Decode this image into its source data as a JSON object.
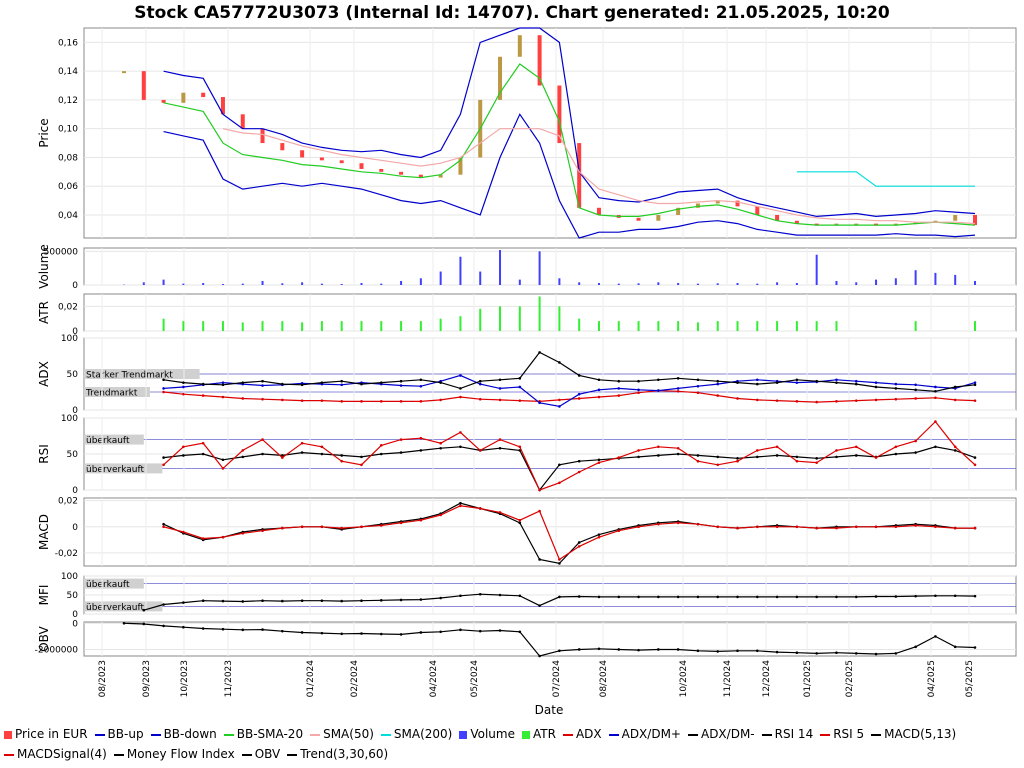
{
  "chart_data": {
    "type": "line",
    "title": "Stock CA57772U3073 (Internal Id: 14707). Chart generated: 21.05.2025, 10:20",
    "xlabel": "Date",
    "x_ticks": [
      "08/2023",
      "09/2023",
      "10/2023",
      "11/2023",
      "01/2024",
      "02/2024",
      "04/2024",
      "05/2024",
      "07/2024",
      "08/2024",
      "10/2024",
      "11/2024",
      "12/2024",
      "01/2025",
      "02/2025",
      "04/2025",
      "05/2025"
    ],
    "panels": [
      {
        "id": "price",
        "ylabel": "Price",
        "ylim": [
          0.024,
          0.17
        ],
        "ticks": [
          "0,16",
          "0,14",
          "0,12",
          "0,10",
          "0,08",
          "0,06",
          "0,04"
        ],
        "tick_values": [
          0.16,
          0.14,
          0.12,
          0.1,
          0.08,
          0.06,
          0.04
        ]
      },
      {
        "id": "volume",
        "ylabel": "Volume",
        "ylim": [
          0,
          550000
        ],
        "ticks": [
          "500000",
          "0"
        ],
        "tick_values": [
          500000,
          0
        ]
      },
      {
        "id": "atr",
        "ylabel": "ATR",
        "ylim": [
          0,
          0.03
        ],
        "ticks": [
          "0,02",
          "0"
        ],
        "tick_values": [
          0.02,
          0
        ]
      },
      {
        "id": "adx",
        "ylabel": "ADX",
        "ylim": [
          0,
          100
        ],
        "ticks": [
          "100",
          "50",
          "0"
        ],
        "tick_values": [
          100,
          50,
          0
        ],
        "annotations": [
          {
            "text": "Starker Trendmarkt",
            "value": 50
          },
          {
            "text": "Trendmarkt",
            "value": 25
          }
        ]
      },
      {
        "id": "rsi",
        "ylabel": "RSI",
        "ylim": [
          0,
          100
        ],
        "ticks": [
          "100",
          "50",
          "0"
        ],
        "tick_values": [
          100,
          50,
          0
        ],
        "annotations": [
          {
            "text": "überkauft",
            "value": 70
          },
          {
            "text": "überverkauft",
            "value": 30
          }
        ]
      },
      {
        "id": "macd",
        "ylabel": "MACD",
        "ylim": [
          -0.03,
          0.022
        ],
        "ticks": [
          "0,02",
          "0",
          "-0,02"
        ],
        "tick_values": [
          0.02,
          0,
          -0.02
        ]
      },
      {
        "id": "mfi",
        "ylabel": "MFI",
        "ylim": [
          0,
          100
        ],
        "ticks": [
          "100",
          "50",
          "0"
        ],
        "tick_values": [
          100,
          50,
          0
        ],
        "annotations": [
          {
            "text": "überkauft",
            "value": 80
          },
          {
            "text": "überverkauft",
            "value": 20
          }
        ]
      },
      {
        "id": "obv",
        "ylabel": "OBV",
        "ylim": [
          -2500000,
          100000
        ],
        "ticks": [
          "0",
          "-2000000"
        ],
        "tick_values": [
          0,
          -2000000
        ]
      }
    ],
    "series": [
      {
        "name": "Price in EUR",
        "panel": "price",
        "color": "#ff4040",
        "values": [
          0.14,
          0.12,
          0.118,
          0.125,
          0.122,
          0.11,
          0.1,
          0.09,
          0.085,
          0.08,
          0.078,
          0.076,
          0.072,
          0.07,
          0.068,
          0.066,
          0.068,
          0.08,
          0.12,
          0.15,
          0.165,
          0.13,
          0.09,
          0.045,
          0.04,
          0.038,
          0.036,
          0.04,
          0.045,
          0.048,
          0.05,
          0.046,
          0.04,
          0.036,
          0.034,
          0.033,
          0.034,
          0.034,
          0.033,
          0.034,
          0.035,
          0.036,
          0.04,
          0.033
        ]
      },
      {
        "name": "BB-up",
        "panel": "price",
        "color": "#0000cc",
        "values": [
          null,
          null,
          0.14,
          0.137,
          0.135,
          0.11,
          0.1,
          0.1,
          0.096,
          0.09,
          0.087,
          0.085,
          0.084,
          0.085,
          0.082,
          0.08,
          0.085,
          0.11,
          0.16,
          0.165,
          0.175,
          0.18,
          0.16,
          0.07,
          0.052,
          0.05,
          0.049,
          0.052,
          0.056,
          0.057,
          0.058,
          0.052,
          0.048,
          0.045,
          0.042,
          0.039,
          0.04,
          0.041,
          0.039,
          0.04,
          0.041,
          0.043,
          0.042,
          0.041
        ]
      },
      {
        "name": "BB-down",
        "panel": "price",
        "color": "#0000cc",
        "values": [
          null,
          null,
          0.098,
          0.095,
          0.092,
          0.065,
          0.058,
          0.06,
          0.062,
          0.06,
          0.062,
          0.06,
          0.058,
          0.054,
          0.05,
          0.048,
          0.05,
          0.045,
          0.04,
          0.08,
          0.11,
          0.09,
          0.05,
          0.01,
          0.028,
          0.028,
          0.03,
          0.03,
          0.032,
          0.035,
          0.036,
          0.034,
          0.03,
          0.028,
          0.026,
          0.026,
          0.026,
          0.026,
          0.026,
          0.027,
          0.026,
          0.026,
          0.025,
          0.026
        ]
      },
      {
        "name": "BB-SMA-20",
        "panel": "price",
        "color": "#22cc22",
        "values": [
          null,
          null,
          0.118,
          0.115,
          0.112,
          0.09,
          0.082,
          0.08,
          0.078,
          0.075,
          0.074,
          0.072,
          0.07,
          0.069,
          0.067,
          0.066,
          0.068,
          0.078,
          0.1,
          0.125,
          0.145,
          0.135,
          0.105,
          0.045,
          0.04,
          0.039,
          0.039,
          0.041,
          0.044,
          0.046,
          0.047,
          0.044,
          0.04,
          0.036,
          0.034,
          0.033,
          0.033,
          0.033,
          0.033,
          0.033,
          0.034,
          0.035,
          0.034,
          0.033
        ]
      },
      {
        "name": "SMA(50)",
        "panel": "price",
        "color": "#f4a8a8",
        "values": [
          null,
          null,
          null,
          null,
          null,
          0.1,
          0.097,
          0.096,
          0.092,
          0.088,
          0.085,
          0.082,
          0.08,
          0.078,
          0.076,
          0.074,
          0.076,
          0.08,
          0.09,
          0.1,
          0.1,
          0.1,
          0.095,
          0.07,
          0.058,
          0.054,
          0.05,
          0.048,
          0.048,
          0.049,
          0.05,
          0.049,
          0.046,
          0.043,
          0.04,
          0.038,
          0.037,
          0.037,
          0.036,
          0.036,
          0.035,
          0.035,
          0.035,
          0.034
        ]
      },
      {
        "name": "SMA(200)",
        "panel": "price",
        "color": "#00dddd",
        "values": [
          null,
          null,
          null,
          null,
          null,
          null,
          null,
          null,
          null,
          null,
          null,
          null,
          null,
          null,
          null,
          null,
          null,
          null,
          null,
          null,
          null,
          null,
          null,
          null,
          null,
          null,
          null,
          null,
          null,
          null,
          null,
          null,
          null,
          null,
          0.07,
          0.07,
          0.07,
          0.07,
          0.06,
          0.06,
          0.06,
          0.06,
          0.06,
          0.06
        ]
      },
      {
        "name": "Volume",
        "panel": "volume",
        "color": "#4040ff",
        "values": [
          5000,
          40000,
          80000,
          20000,
          30000,
          15000,
          20000,
          60000,
          25000,
          40000,
          20000,
          15000,
          30000,
          20000,
          60000,
          100000,
          200000,
          420000,
          200000,
          520000,
          80000,
          500000,
          100000,
          40000,
          30000,
          20000,
          25000,
          40000,
          30000,
          20000,
          25000,
          30000,
          20000,
          40000,
          30000,
          450000,
          60000,
          40000,
          80000,
          100000,
          220000,
          180000,
          150000,
          60000
        ]
      },
      {
        "name": "ATR",
        "panel": "atr",
        "color": "#33ee33",
        "values": [
          null,
          null,
          0.01,
          0.008,
          0.008,
          0.008,
          0.007,
          0.008,
          0.008,
          0.007,
          0.008,
          0.008,
          0.008,
          0.008,
          0.008,
          0.008,
          0.01,
          0.012,
          0.018,
          0.02,
          0.02,
          0.028,
          0.02,
          0.01,
          0.008,
          0.008,
          0.008,
          0.008,
          0.008,
          0.007,
          0.008,
          0.008,
          0.008,
          0.008,
          0.008,
          0.008,
          0.008,
          null,
          null,
          null,
          0.008,
          null,
          null,
          0.008
        ]
      },
      {
        "name": "ADX",
        "panel": "adx",
        "color": "#dd0000",
        "values": [
          null,
          null,
          25,
          22,
          20,
          18,
          16,
          15,
          14,
          13,
          13,
          12,
          12,
          12,
          12,
          12,
          14,
          18,
          15,
          14,
          13,
          12,
          14,
          16,
          18,
          20,
          24,
          27,
          26,
          24,
          20,
          16,
          14,
          13,
          12,
          11,
          12,
          13,
          14,
          15,
          16,
          17,
          14,
          13
        ]
      },
      {
        "name": "ADX/DM+",
        "panel": "adx",
        "color": "#0000cc",
        "values": [
          null,
          null,
          30,
          32,
          35,
          38,
          36,
          34,
          35,
          37,
          36,
          35,
          38,
          36,
          34,
          33,
          40,
          48,
          36,
          30,
          32,
          10,
          5,
          22,
          28,
          30,
          28,
          27,
          30,
          33,
          36,
          40,
          42,
          40,
          38,
          39,
          42,
          40,
          38,
          36,
          35,
          32,
          30,
          38
        ]
      },
      {
        "name": "ADX/DM-",
        "panel": "adx",
        "color": "#000000",
        "values": [
          null,
          null,
          42,
          38,
          36,
          35,
          38,
          40,
          36,
          35,
          38,
          40,
          36,
          38,
          40,
          42,
          38,
          30,
          40,
          42,
          44,
          80,
          66,
          48,
          42,
          40,
          40,
          42,
          44,
          42,
          40,
          38,
          36,
          38,
          42,
          40,
          38,
          36,
          32,
          30,
          28,
          26,
          32,
          35
        ]
      },
      {
        "name": "RSI 14",
        "panel": "rsi",
        "color": "#000000",
        "values": [
          null,
          null,
          45,
          48,
          50,
          42,
          46,
          50,
          48,
          52,
          50,
          48,
          46,
          50,
          52,
          55,
          58,
          60,
          55,
          58,
          55,
          0,
          35,
          40,
          42,
          44,
          46,
          48,
          50,
          48,
          46,
          44,
          46,
          48,
          46,
          44,
          46,
          48,
          46,
          50,
          52,
          60,
          55,
          45
        ]
      },
      {
        "name": "RSI 5",
        "panel": "rsi",
        "color": "#dd0000",
        "values": [
          null,
          null,
          35,
          60,
          65,
          30,
          55,
          70,
          45,
          65,
          60,
          40,
          35,
          62,
          70,
          72,
          65,
          80,
          55,
          70,
          60,
          0,
          10,
          25,
          38,
          45,
          55,
          60,
          58,
          40,
          35,
          40,
          55,
          60,
          40,
          38,
          55,
          60,
          45,
          60,
          68,
          95,
          60,
          35
        ]
      },
      {
        "name": "MACD(5,13)",
        "panel": "macd",
        "color": "#000000",
        "values": [
          null,
          null,
          0.002,
          -0.005,
          -0.01,
          -0.008,
          -0.004,
          -0.002,
          -0.001,
          0.0,
          0.0,
          -0.002,
          0.0,
          0.002,
          0.004,
          0.006,
          0.01,
          0.018,
          0.014,
          0.01,
          0.003,
          -0.025,
          -0.028,
          -0.012,
          -0.006,
          -0.002,
          0.001,
          0.003,
          0.004,
          0.002,
          0.0,
          -0.001,
          0.0,
          0.001,
          0.0,
          -0.001,
          0.0,
          0.0,
          0.0,
          0.001,
          0.002,
          0.001,
          -0.001,
          -0.001
        ]
      },
      {
        "name": "MACDSignal(4)",
        "panel": "macd",
        "color": "#dd0000",
        "values": [
          null,
          null,
          0.0,
          -0.004,
          -0.009,
          -0.008,
          -0.005,
          -0.003,
          -0.001,
          0.0,
          0.0,
          -0.001,
          0.0,
          0.001,
          0.003,
          0.005,
          0.009,
          0.016,
          0.014,
          0.011,
          0.005,
          0.012,
          -0.025,
          -0.015,
          -0.008,
          -0.003,
          0.0,
          0.002,
          0.003,
          0.002,
          0.0,
          -0.001,
          0.0,
          0.0,
          0.0,
          -0.001,
          -0.001,
          0.0,
          0.0,
          0.0,
          0.001,
          0.0,
          -0.001,
          -0.001
        ]
      },
      {
        "name": "Money Flow Index",
        "panel": "mfi",
        "color": "#000000",
        "values": [
          null,
          10,
          25,
          30,
          35,
          34,
          33,
          35,
          34,
          35,
          35,
          34,
          35,
          36,
          37,
          38,
          42,
          48,
          52,
          50,
          48,
          22,
          45,
          46,
          45,
          45,
          45,
          45,
          45,
          45,
          45,
          45,
          45,
          45,
          45,
          45,
          45,
          45,
          46,
          46,
          47,
          48,
          48,
          47
        ]
      },
      {
        "name": "OBV",
        "panel": "obv",
        "color": "#000000",
        "values": [
          0,
          -50000,
          -200000,
          -300000,
          -400000,
          -450000,
          -500000,
          -480000,
          -600000,
          -700000,
          -750000,
          -800000,
          -780000,
          -820000,
          -850000,
          -700000,
          -650000,
          -500000,
          -600000,
          -550000,
          -650000,
          -2500000,
          -2100000,
          -2000000,
          -1950000,
          -2000000,
          -2050000,
          -2000000,
          -2000000,
          -2100000,
          -2150000,
          -2100000,
          -2100000,
          -2200000,
          -2250000,
          -2300000,
          -2250000,
          -2300000,
          -2350000,
          -2300000,
          -1800000,
          -1000000,
          -1800000,
          -1850000
        ]
      },
      {
        "name": "Trend(3,30,60)",
        "panel": "legend",
        "color": "#000000",
        "values": []
      }
    ]
  }
}
